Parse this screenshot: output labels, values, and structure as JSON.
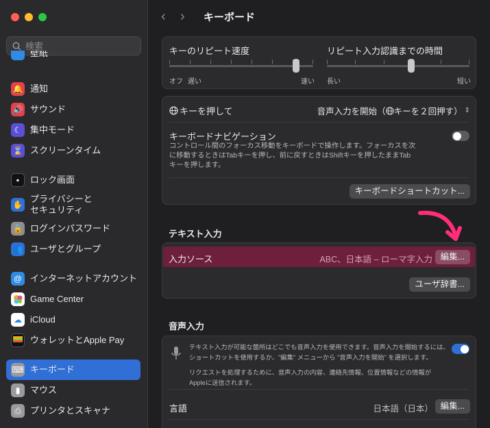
{
  "sidebar": {
    "search_placeholder": "検索",
    "partial_top_label": "壁紙",
    "items": [
      {
        "label": "通知",
        "icon": "bell-icon",
        "color": "#e8404a"
      },
      {
        "label": "サウンド",
        "icon": "speaker-icon",
        "color": "#e8404a"
      },
      {
        "label": "集中モード",
        "icon": "moon-icon",
        "color": "#5b4fd6"
      },
      {
        "label": "スクリーンタイム",
        "icon": "hourglass-icon",
        "color": "#5b4fd6"
      },
      {
        "label": "ロック画面",
        "icon": "lock-screen-icon",
        "color": "#1a1a1a"
      },
      {
        "label": "プライバシーと",
        "label2": "セキュリティ",
        "icon": "hand-icon",
        "color": "#2f6fd6"
      },
      {
        "label": "ログインパスワード",
        "icon": "padlock-icon",
        "color": "#8e8e93"
      },
      {
        "label": "ユーザとグループ",
        "icon": "users-icon",
        "color": "#2f6fd6"
      },
      {
        "label": "インターネットアカウント",
        "icon": "at-icon",
        "color": "#2f8be6"
      },
      {
        "label": "Game Center",
        "icon": "game-center-icon",
        "color": "#ffffff"
      },
      {
        "label": "iCloud",
        "icon": "cloud-icon",
        "color": "#ffffff"
      },
      {
        "label": "ウォレットとApple Pay",
        "icon": "wallet-icon",
        "color": "#1a1a1a"
      },
      {
        "label": "キーボード",
        "icon": "keyboard-icon",
        "color": "#9a9a9e"
      },
      {
        "label": "マウス",
        "icon": "mouse-icon",
        "color": "#9a9a9e"
      },
      {
        "label": "プリンタとスキャナ",
        "icon": "printer-icon",
        "color": "#9a9a9e"
      }
    ]
  },
  "header": {
    "title": "キーボード",
    "back": "‹",
    "forward": "›"
  },
  "repeat": {
    "rate_label": "キーのリピート速度",
    "rate_min": "オフ",
    "rate_slow": "遅い",
    "rate_fast": "速い",
    "rate_value": 0.88,
    "delay_label": "リピート入力認識までの時間",
    "delay_long": "長い",
    "delay_short": "短い",
    "delay_value": 0.59
  },
  "globe": {
    "label": "キーを押して",
    "value": "音声入力を開始（",
    "value2": "キーを２回押す）"
  },
  "kbnav": {
    "title": "キーボードナビゲーション",
    "desc1": "コントロール間のフォーカス移動をキーボードで操作します。フォーカスを次",
    "desc2": "に移動するときはTabキーを押し、前に戻すときはShiftキーを押したままTab",
    "desc3": "キーを押します。",
    "shortcut_btn": "キーボードショートカット..."
  },
  "text_input": {
    "section": "テキスト入力",
    "source_label": "入力ソース",
    "source_value": "ABC、日本語 – ローマ字入力",
    "edit_btn": "編集...",
    "dict_btn": "ユーザ辞書..."
  },
  "dictation": {
    "section": "音声入力",
    "desc1": "テキスト入力が可能な箇所はどこでも音声入力を使用できます。音声入力を開始するには、",
    "desc2": "ショートカットを使用するか、\"編集\" メニューから \"音声入力を開始\" を選択します。",
    "desc3": "リクエストを処理するために、音声入力の内容、連絡先情報、位置情報などの情報が",
    "desc4": "Appleに送信されます。",
    "lang_label": "言語",
    "lang_value": "日本語（日本）",
    "edit_btn": "編集..."
  },
  "colors": {
    "accent": "#2f6fd6",
    "highlight": "#6d1f3c",
    "arrow": "#ff2d7a"
  }
}
